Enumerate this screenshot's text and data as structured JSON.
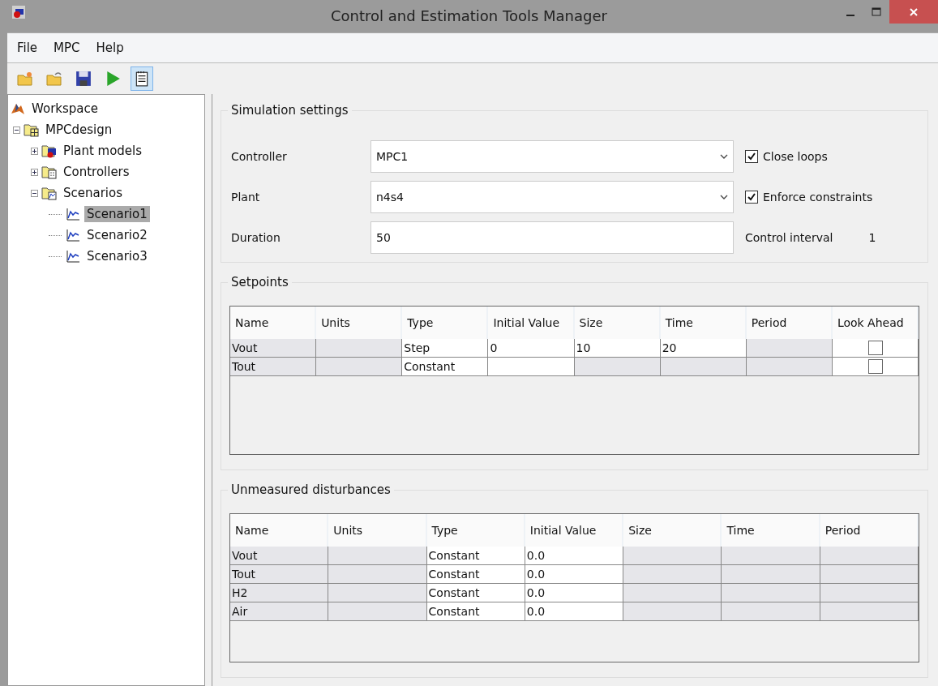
{
  "window": {
    "title": "Control and Estimation Tools Manager"
  },
  "menu": [
    {
      "label": "File"
    },
    {
      "label": "MPC"
    },
    {
      "label": "Help"
    }
  ],
  "toolbar": [
    {
      "kind": "new",
      "selected": false
    },
    {
      "kind": "open",
      "selected": false
    },
    {
      "kind": "save",
      "selected": false
    },
    {
      "kind": "run",
      "selected": false
    },
    {
      "kind": "notes",
      "selected": true
    }
  ],
  "tree": [
    {
      "label": "Workspace",
      "kind": "workspace",
      "selected": false,
      "children": [
        {
          "label": "MPCdesign",
          "kind": "project",
          "expanded": true,
          "selected": false,
          "children": [
            {
              "label": "Plant models",
              "kind": "plants",
              "expanded": false,
              "selected": false
            },
            {
              "label": "Controllers",
              "kind": "controllers",
              "expanded": false,
              "selected": false
            },
            {
              "label": "Scenarios",
              "kind": "scenarios",
              "expanded": true,
              "selected": false,
              "children": [
                {
                  "label": "Scenario1",
                  "kind": "scenario",
                  "selected": true
                },
                {
                  "label": "Scenario2",
                  "kind": "scenario",
                  "selected": false
                },
                {
                  "label": "Scenario3",
                  "kind": "scenario",
                  "selected": false
                }
              ]
            }
          ]
        }
      ]
    }
  ],
  "simulation_settings": {
    "title": "Simulation settings",
    "fields": [
      {
        "label": "Controller",
        "kind": "dropdown",
        "value": "MPC1"
      },
      {
        "label": "Plant",
        "kind": "dropdown",
        "value": "n4s4"
      },
      {
        "label": "Duration",
        "kind": "text",
        "value": "50"
      }
    ],
    "options": [
      {
        "label": "Close loops",
        "checked": true
      },
      {
        "label": "Enforce constraints",
        "checked": true
      }
    ],
    "control_interval": {
      "label": "Control interval",
      "value": "1"
    }
  },
  "setpoints": {
    "title": "Setpoints",
    "columns": [
      "Name",
      "Units",
      "Type",
      "Initial Value",
      "Size",
      "Time",
      "Period",
      "Look Ahead"
    ],
    "rows": [
      [
        {
          "text": "Vout",
          "editable": false
        },
        {
          "editable": false
        },
        {
          "text": "Step",
          "editable": true
        },
        {
          "text": "0",
          "editable": true
        },
        {
          "text": "10",
          "editable": true
        },
        {
          "text": "20",
          "editable": true
        },
        {
          "editable": false
        },
        {
          "kind": "checkbox",
          "checked": false,
          "editable": true
        }
      ],
      [
        {
          "text": "Tout",
          "editable": false
        },
        {
          "editable": false
        },
        {
          "text": "Constant",
          "editable": true
        },
        {
          "editable": true
        },
        {
          "editable": false
        },
        {
          "editable": false
        },
        {
          "editable": false
        },
        {
          "kind": "checkbox",
          "checked": false,
          "editable": true
        }
      ]
    ]
  },
  "unmeasured_disturbances": {
    "title": "Unmeasured disturbances",
    "columns": [
      "Name",
      "Units",
      "Type",
      "Initial Value",
      "Size",
      "Time",
      "Period"
    ],
    "rows": [
      [
        {
          "text": "Vout",
          "editable": false
        },
        {
          "editable": false
        },
        {
          "text": "Constant",
          "editable": true
        },
        {
          "text": "0.0",
          "editable": true
        },
        {
          "editable": false
        },
        {
          "editable": false
        },
        {
          "editable": false
        }
      ],
      [
        {
          "text": "Tout",
          "editable": false
        },
        {
          "editable": false
        },
        {
          "text": "Constant",
          "editable": true
        },
        {
          "text": "0.0",
          "editable": true
        },
        {
          "editable": false
        },
        {
          "editable": false
        },
        {
          "editable": false
        }
      ],
      [
        {
          "text": "H2",
          "editable": false
        },
        {
          "editable": false
        },
        {
          "text": "Constant",
          "editable": true
        },
        {
          "text": "0.0",
          "editable": true
        },
        {
          "editable": false
        },
        {
          "editable": false
        },
        {
          "editable": false
        }
      ],
      [
        {
          "text": "Air",
          "editable": false
        },
        {
          "editable": false
        },
        {
          "text": "Constant",
          "editable": true
        },
        {
          "text": "0.0",
          "editable": true
        },
        {
          "editable": false
        },
        {
          "editable": false
        },
        {
          "editable": false
        }
      ]
    ]
  }
}
